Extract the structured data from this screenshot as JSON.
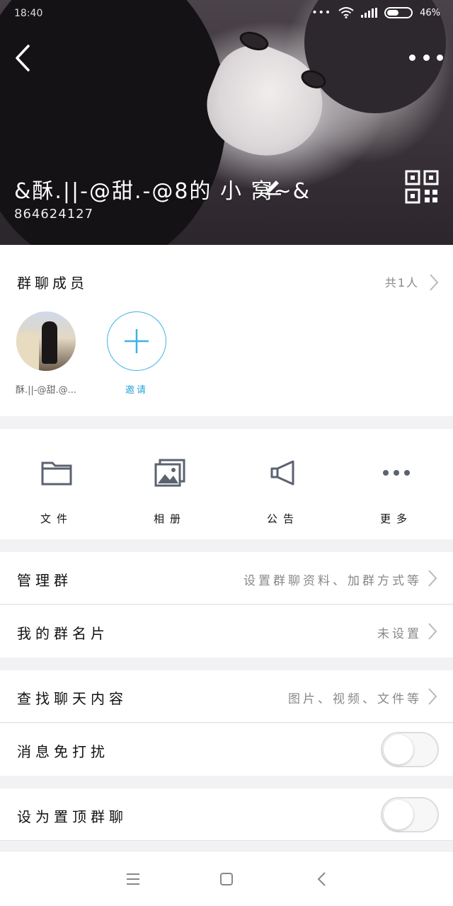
{
  "status_bar": {
    "time": "18:40",
    "battery": "46%"
  },
  "header": {
    "group_name": "&酥.||-@甜.-@8的 小 窝~&",
    "group_id": "864624127",
    "back_icon": "chevron-left-icon",
    "more_icon": "more-horizontal-icon",
    "edit_icon": "pencil-icon",
    "qr_icon": "qr-code-icon"
  },
  "members": {
    "title": "群聊成员",
    "count_label": "共1人",
    "list": [
      {
        "name": "酥.||-@甜.@..."
      }
    ],
    "invite_label": "邀请"
  },
  "features": [
    {
      "label": "文件",
      "icon": "folder-icon"
    },
    {
      "label": "相册",
      "icon": "photo-album-icon"
    },
    {
      "label": "公告",
      "icon": "megaphone-icon"
    },
    {
      "label": "更多",
      "icon": "more-horizontal-icon"
    }
  ],
  "settings": {
    "manage_group": {
      "label": "管理群",
      "value": "设置群聊资料、加群方式等"
    },
    "my_card": {
      "label": "我的群名片",
      "value": "未设置"
    },
    "search_chat": {
      "label": "查找聊天内容",
      "value": "图片、视频、文件等"
    },
    "do_not_disturb": {
      "label": "消息免打扰",
      "on": false
    },
    "pin_top": {
      "label": "设为置顶群聊",
      "on": false
    }
  },
  "colors": {
    "accent": "#3db3e6",
    "icon_gray": "#5b6270"
  }
}
